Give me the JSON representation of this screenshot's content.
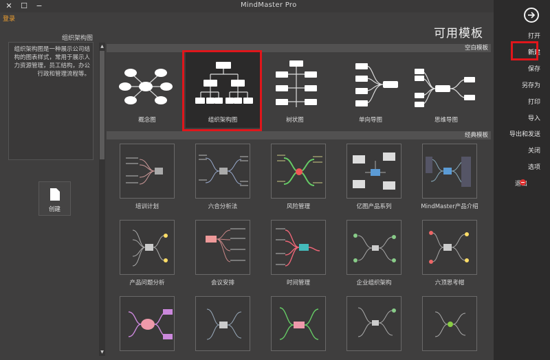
{
  "window": {
    "title": "MindMaster Pro",
    "login_label": "登录",
    "controls": {
      "close": "✕",
      "maximize": "☐",
      "minimize": "−"
    }
  },
  "sidebar": {
    "back_icon": "arrow-right-circle-icon",
    "items": [
      {
        "label": "打开"
      },
      {
        "label": "新建",
        "active": true
      },
      {
        "label": "保存"
      },
      {
        "label": "另存为"
      },
      {
        "label": "打印"
      },
      {
        "label": "导入"
      },
      {
        "label": "导出和发送"
      },
      {
        "label": "关闭"
      },
      {
        "label": "选项"
      },
      {
        "label": "退出"
      }
    ]
  },
  "left_panel": {
    "heading": "组织架构图",
    "description": "组织架构图是一种展示公司结构的图表样式，常用于展示人力资源管理，员工结构，办公行政和管理流程等。",
    "create_label": "创建"
  },
  "main": {
    "page_title": "可用模板",
    "blank_section_title": "空白模板",
    "classic_section_title": "经典模板",
    "blank_templates": [
      {
        "label": "思维导图",
        "icon": "mind-map-icon"
      },
      {
        "label": "单向导图",
        "icon": "right-map-icon"
      },
      {
        "label": "树状图",
        "icon": "tree-chart-icon"
      },
      {
        "label": "组织架构图",
        "icon": "org-chart-icon",
        "selected": true
      },
      {
        "label": "概念图",
        "icon": "concept-map-icon"
      }
    ],
    "classic_templates": [
      {
        "label": "MindMaster产品介绍"
      },
      {
        "label": "亿图产品系列"
      },
      {
        "label": "风险管理"
      },
      {
        "label": "六合分析法"
      },
      {
        "label": "培训计划"
      },
      {
        "label": "六顶思考帽"
      },
      {
        "label": "企业组织架构"
      },
      {
        "label": "时间管理"
      },
      {
        "label": "会议安排"
      },
      {
        "label": "产品问题分析"
      },
      {
        "label": ""
      },
      {
        "label": ""
      },
      {
        "label": ""
      },
      {
        "label": ""
      },
      {
        "label": ""
      }
    ]
  },
  "colors": {
    "accent_red": "#e0161b",
    "login_orange": "#f0a030",
    "background": "#3f3e3e",
    "sidebar": "#2c2b2b"
  }
}
